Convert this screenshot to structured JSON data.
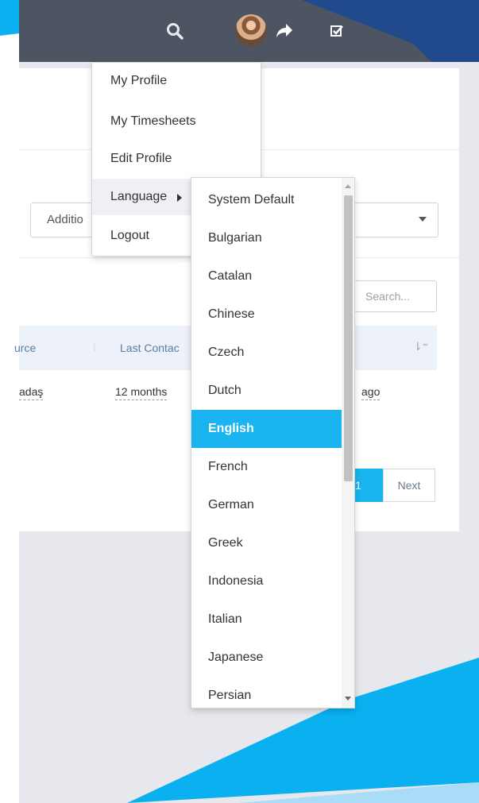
{
  "topbar": {
    "icons": [
      "search-icon",
      "avatar",
      "share-icon",
      "checkbox-icon"
    ]
  },
  "user_menu": {
    "items": [
      "My Profile",
      "My Timesheets",
      "Edit Profile",
      "Language",
      "Logout"
    ]
  },
  "language_menu": {
    "options": [
      "System Default",
      "Bulgarian",
      "Catalan",
      "Chinese",
      "Czech",
      "Dutch",
      "English",
      "French",
      "German",
      "Greek",
      "Indonesia",
      "Italian",
      "Japanese",
      "Persian"
    ],
    "selected": "English"
  },
  "filter": {
    "select_value": "Additio"
  },
  "search": {
    "placeholder": "Search..."
  },
  "table": {
    "headers": [
      "urce",
      "Last Contac"
    ],
    "row": {
      "source": "adaş",
      "last_contact": "12 months",
      "last_col": "ago"
    }
  },
  "pagination": {
    "current": "1",
    "next": "Next"
  },
  "colors": {
    "accent": "#1ab5f0",
    "topbar": "#4c5561",
    "deco_dark": "#214a8c",
    "deco_light": "#0ab0ef"
  }
}
